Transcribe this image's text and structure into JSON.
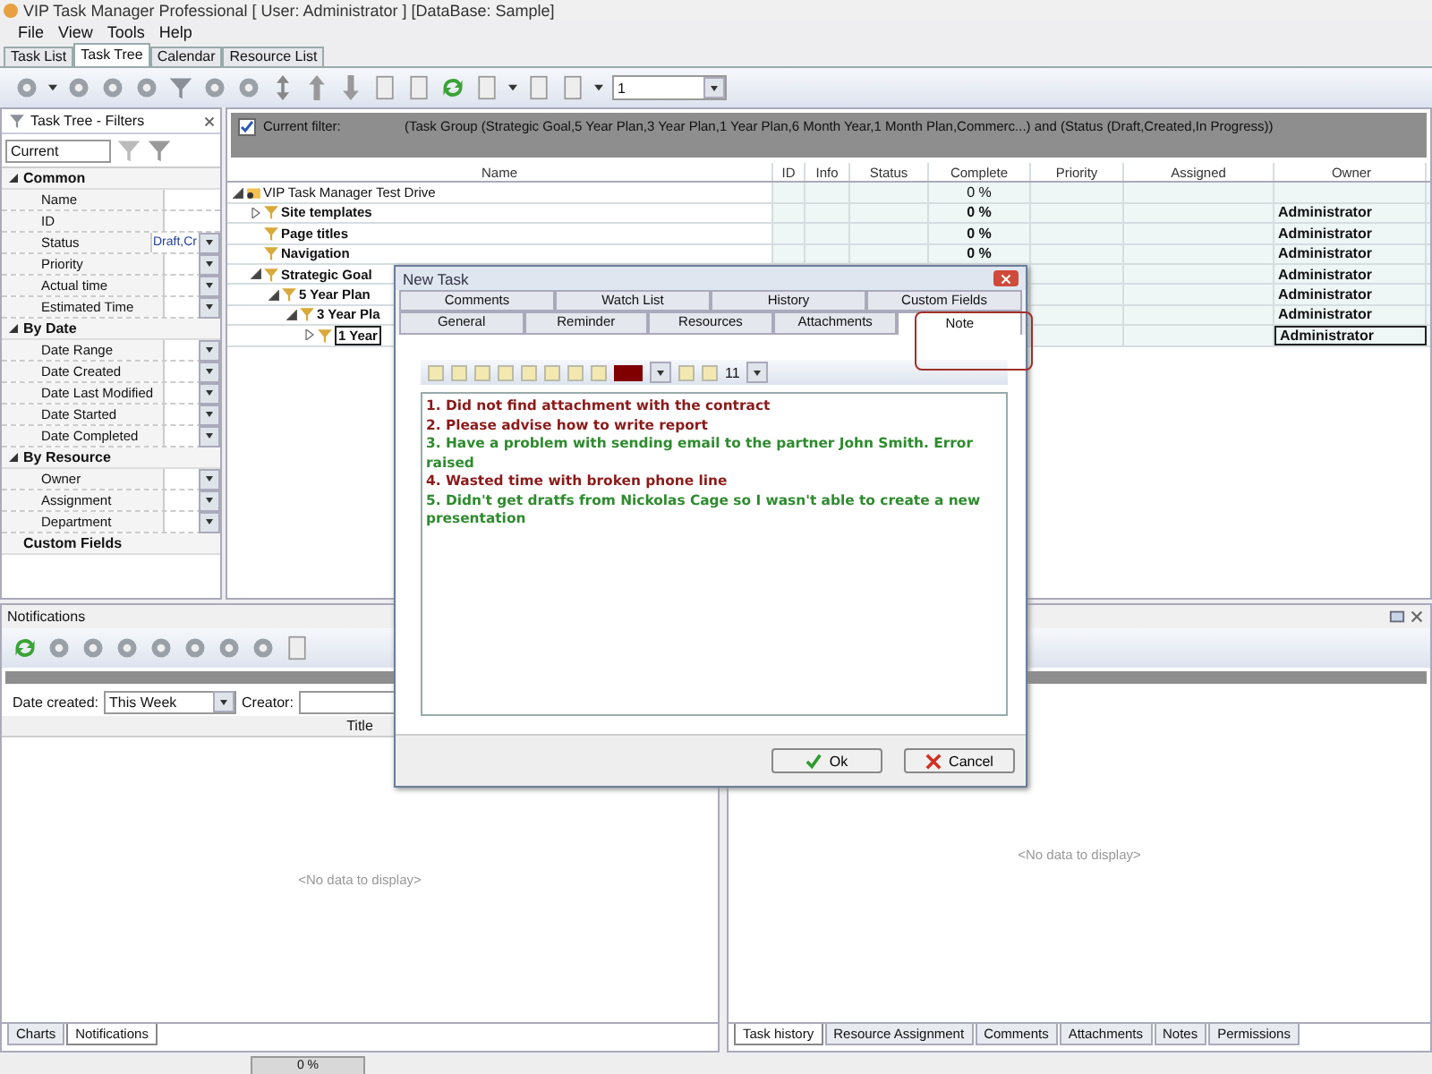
{
  "window": {
    "title": "VIP Task Manager Professional [ User: Administrator ] [DataBase: Sample]"
  },
  "menu": [
    "File",
    "View",
    "Tools",
    "Help"
  ],
  "tabs": [
    {
      "label": "Task List",
      "selected": false
    },
    {
      "label": "Task Tree",
      "selected": true
    },
    {
      "label": "Calendar",
      "selected": false
    },
    {
      "label": "Resource List",
      "selected": false
    }
  ],
  "toolbar": {
    "page_field": "1"
  },
  "filters_panel": {
    "title": "Task Tree - Filters",
    "preset": "Current",
    "groups": [
      {
        "label": "Common",
        "expanded": true,
        "children": [
          {
            "label": "Name",
            "dropdown": false
          },
          {
            "label": "ID",
            "dropdown": false
          },
          {
            "label": "Status",
            "value": "Draft,Cr",
            "dropdown": true
          },
          {
            "label": "Priority",
            "dropdown": true
          },
          {
            "label": "Actual time",
            "dropdown": true
          },
          {
            "label": "Estimated Time",
            "dropdown": true
          }
        ]
      },
      {
        "label": "By Date",
        "expanded": true,
        "children": [
          {
            "label": "Date Range",
            "dropdown": true
          },
          {
            "label": "Date Created",
            "dropdown": true
          },
          {
            "label": "Date Last Modified",
            "dropdown": true
          },
          {
            "label": "Date Started",
            "dropdown": true
          },
          {
            "label": "Date Completed",
            "dropdown": true
          }
        ]
      },
      {
        "label": "By Resource",
        "expanded": true,
        "children": [
          {
            "label": "Owner",
            "dropdown": true
          },
          {
            "label": "Assignment",
            "dropdown": true
          },
          {
            "label": "Department",
            "dropdown": true
          }
        ]
      },
      {
        "label": "Custom Fields"
      }
    ]
  },
  "filter_bar": {
    "checked": true,
    "label": "Current filter:",
    "expression": "(Task Group  (Strategic Goal,5 Year Plan,3 Year Plan,1 Year Plan,6 Month Year,1 Month Plan,Commerc...) and (Status  (Draft,Created,In Progress))"
  },
  "grid": {
    "columns": [
      "Name",
      "ID",
      "Info",
      "Status",
      "Complete",
      "Priority",
      "Assigned",
      "Owner"
    ],
    "rows": [
      {
        "kind": "project",
        "name": "VIP Task Manager Test Drive",
        "complete": "0 %",
        "expanded": true,
        "selected": false,
        "children": [
          {
            "kind": "task",
            "name": "Site templates",
            "complete": "0 %",
            "owner": "Administrator",
            "expanded": false,
            "selected": false
          },
          {
            "kind": "task",
            "name": "Page titles",
            "complete": "0 %",
            "owner": "Administrator",
            "selected": false
          },
          {
            "kind": "task",
            "name": "Navigation",
            "complete": "0 %",
            "owner": "Administrator",
            "selected": false
          },
          {
            "kind": "task",
            "name": "Strategic Goal",
            "owner": "Administrator",
            "expanded": true,
            "selected": false,
            "children": [
              {
                "kind": "task",
                "name": "5 Year Plan",
                "owner": "Administrator",
                "expanded": true,
                "selected": false,
                "children": [
                  {
                    "kind": "task",
                    "name": "3 Year Pla",
                    "owner": "Administrator",
                    "expanded": true,
                    "selected": false,
                    "children": [
                      {
                        "kind": "task",
                        "name": "1 Year",
                        "owner": "Administrator",
                        "expanded": false,
                        "selected": true
                      }
                    ]
                  }
                ]
              }
            ]
          }
        ]
      }
    ]
  },
  "notifications": {
    "title": "Notifications",
    "date_label": "Date created:",
    "date_value": "This Week",
    "creator_label": "Creator:",
    "column": "Title",
    "empty": "<No data to display>",
    "tabs": [
      {
        "label": "Charts",
        "selected": false
      },
      {
        "label": "Notifications",
        "selected": true
      }
    ]
  },
  "details": {
    "empty": "<No data to display>",
    "tabs": [
      {
        "label": "Task history",
        "selected": true
      },
      {
        "label": "Resource Assignment",
        "selected": false
      },
      {
        "label": "Comments",
        "selected": false
      },
      {
        "label": "Attachments",
        "selected": false
      },
      {
        "label": "Notes",
        "selected": false
      },
      {
        "label": "Permissions",
        "selected": false
      }
    ]
  },
  "dialog": {
    "title": "New Task",
    "tabs_back": [
      {
        "label": "Comments",
        "selected": false
      },
      {
        "label": "Watch List",
        "selected": false
      },
      {
        "label": "History",
        "selected": false
      },
      {
        "label": "Custom Fields",
        "selected": false
      }
    ],
    "tabs_front": [
      {
        "label": "General",
        "selected": false
      },
      {
        "label": "Reminder",
        "selected": false
      },
      {
        "label": "Resources",
        "selected": false
      },
      {
        "label": "Attachments",
        "selected": false
      },
      {
        "label": "Note",
        "selected": true
      }
    ],
    "color_picker": {
      "color": "#800000"
    },
    "font_size": "11",
    "note_lines": [
      {
        "text": "1. Did not find attachment with the contract",
        "color": "#8b1a1a"
      },
      {
        "text": "2. Please advise how to write report",
        "color": "#8b1a1a"
      },
      {
        "text": "3. Have a problem with sending email to the partner John Smith. Error raised",
        "color": "#2e8b2e"
      },
      {
        "text": "4. Wasted time with broken phone line",
        "color": "#8b1a1a"
      },
      {
        "text": "5. Didn't get dratfs from Nickolas Cage so I wasn't able to create a new presentation",
        "color": "#2e8b2e"
      }
    ],
    "buttons": [
      {
        "kind": "ok",
        "label": "Ok"
      },
      {
        "kind": "cancel",
        "label": "Cancel"
      }
    ]
  },
  "status_bar": {
    "progress": {
      "level": 0,
      "label": "0 %"
    }
  }
}
